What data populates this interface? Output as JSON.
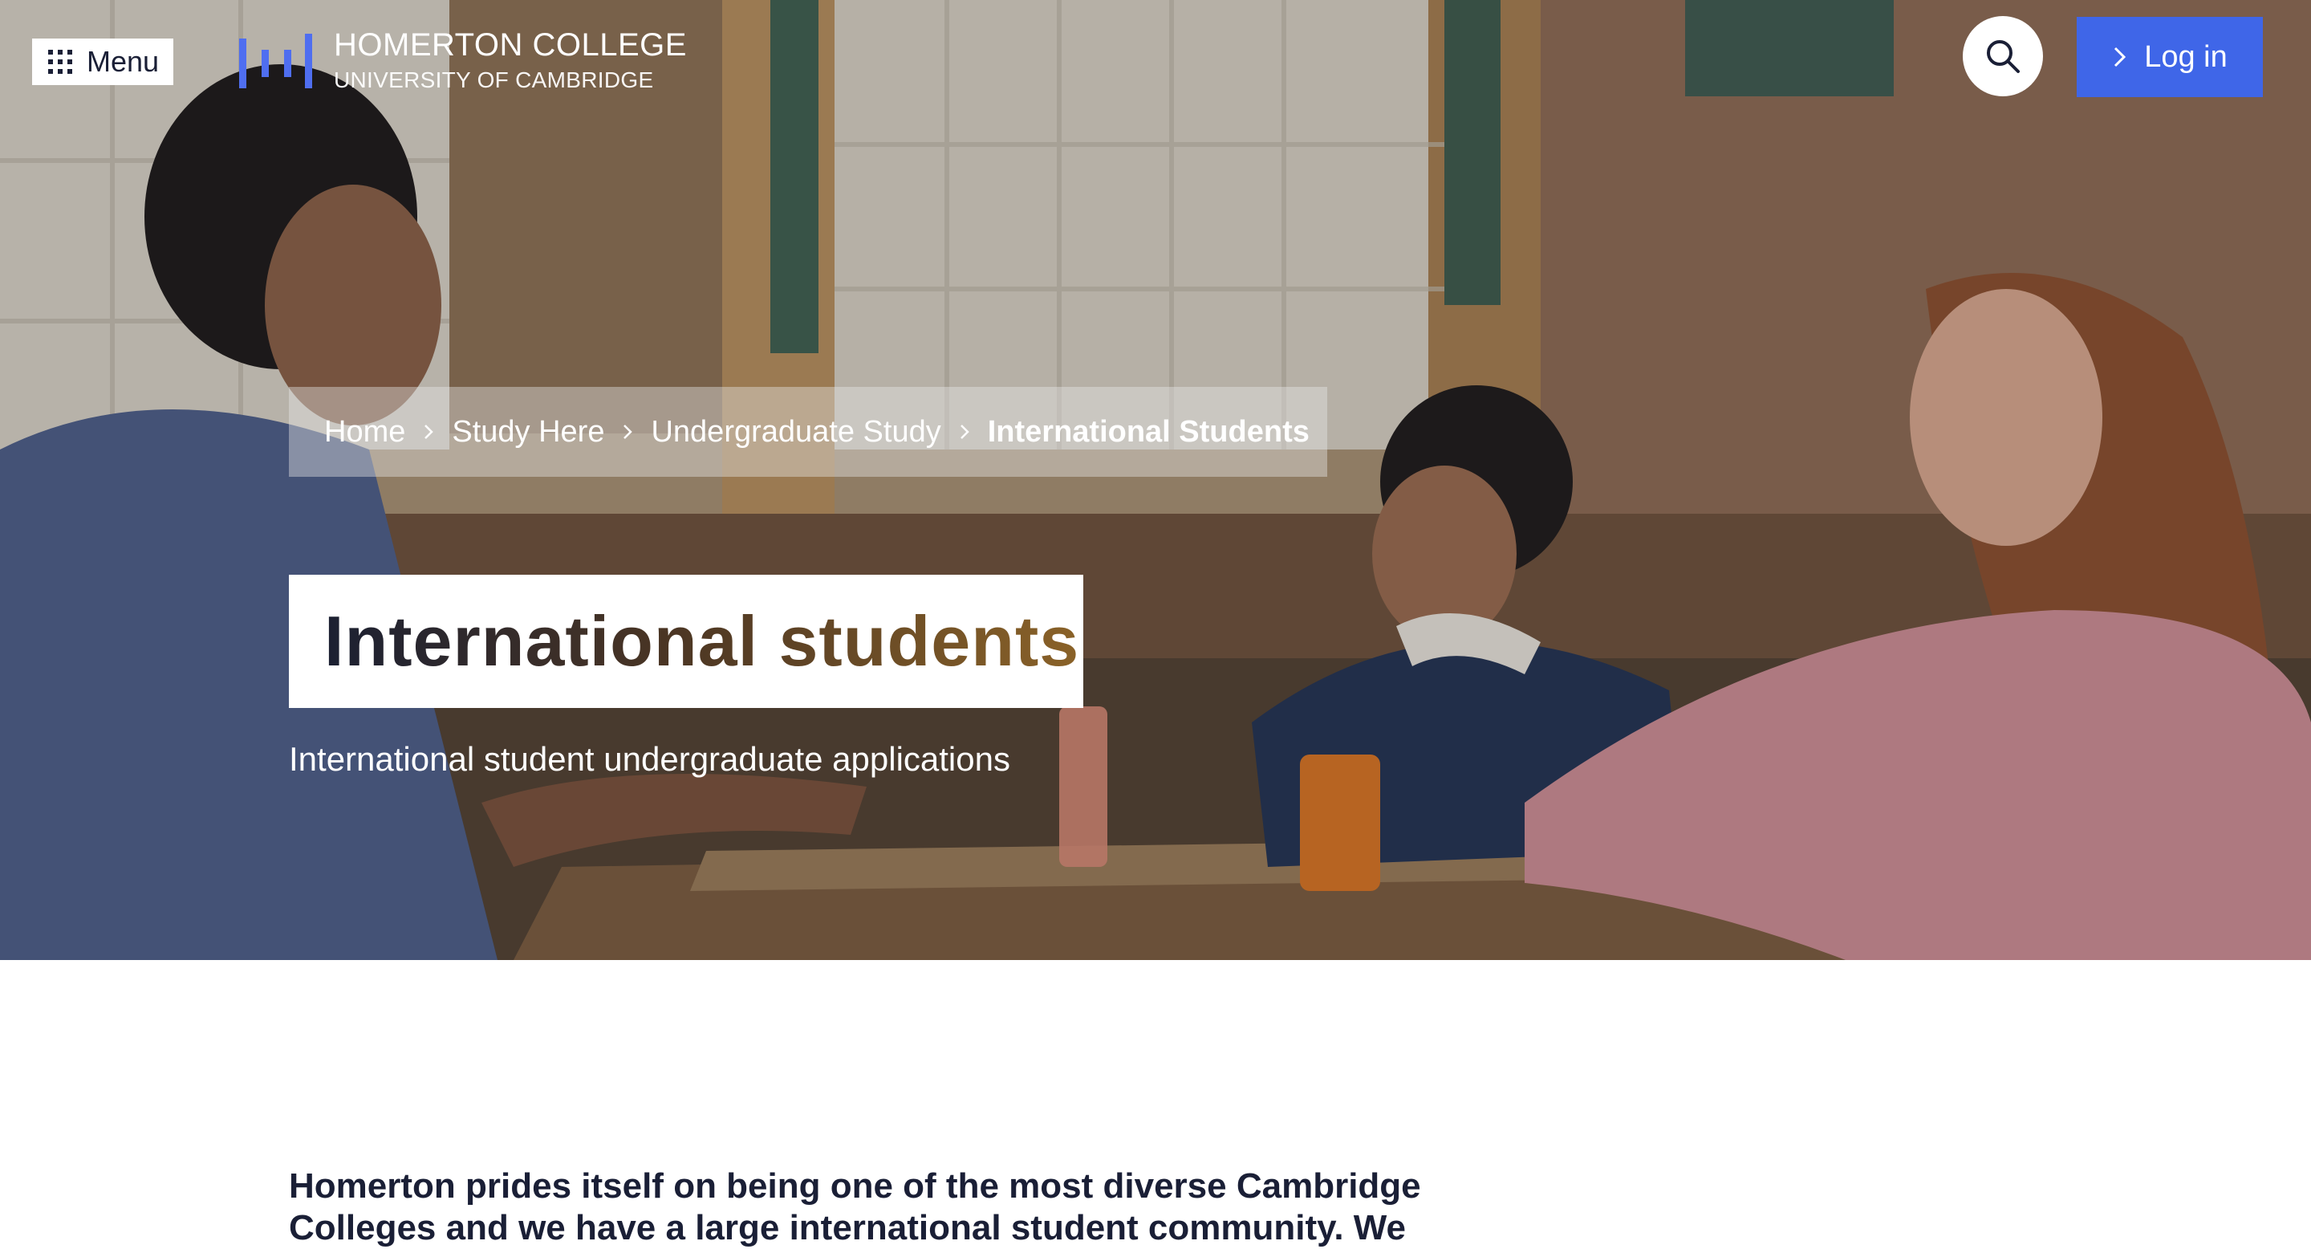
{
  "header": {
    "menu_label": "Menu",
    "logo_title": "HOMERTON COLLEGE",
    "logo_subtitle": "UNIVERSITY OF CAMBRIDGE",
    "login_label": "Log in"
  },
  "breadcrumb": {
    "items": [
      "Home",
      "Study Here",
      "Undergraduate Study"
    ],
    "current": "International Students"
  },
  "hero": {
    "title": "International students",
    "subtitle": "International student undergraduate applications"
  },
  "main": {
    "intro": "Homerton prides itself on being one of the most diverse Cambridge Colleges and we have a large international student community. We"
  },
  "colors": {
    "accent": "#3f66e8",
    "logo_accent": "#4f6ef0",
    "text_dark": "#1a1f36"
  },
  "icons": {
    "menu": "grid-icon",
    "search": "search-icon",
    "login": "chevron-right-icon",
    "breadcrumb_separator": "chevron-right-icon"
  }
}
